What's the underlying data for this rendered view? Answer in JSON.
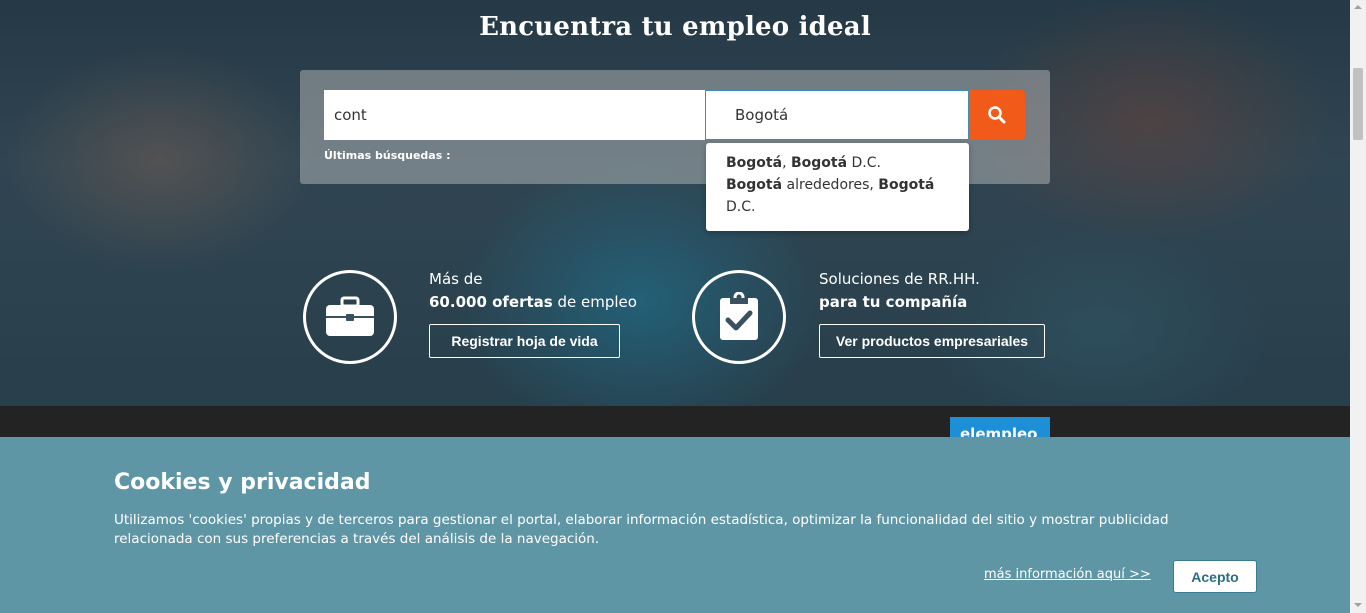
{
  "hero": {
    "title": "Encuentra tu empleo ideal"
  },
  "search": {
    "keyword_value": "cont",
    "location_value": "Bogotá",
    "recent_label": "Últimas búsquedas :",
    "button_icon": "search-icon",
    "button_color": "#f25a1a"
  },
  "suggestions": [
    {
      "bold1": "Bogotá",
      "sep": ", ",
      "bold2": "Bogotá",
      "rest": " D.C."
    },
    {
      "bold1": "Bogotá",
      "sep": " alrededores, ",
      "bold2": "Bogotá",
      "rest": " D.C."
    }
  ],
  "features": {
    "candidates": {
      "icon": "briefcase-icon",
      "line1": "Más de",
      "line2_bold": "60.000 ofertas",
      "line2_rest": " de empleo",
      "button": "Registrar hoja de vida"
    },
    "companies": {
      "icon": "clipboard-check-icon",
      "line1": "Soluciones de RR.HH.",
      "line2_bold": "para tu compañía",
      "button": "Ver productos empresariales"
    }
  },
  "logo": {
    "text": "elempleo"
  },
  "cookies": {
    "title": "Cookies y privacidad",
    "text": "Utilizamos 'cookies' propias y de terceros para gestionar el portal, elaborar información estadística, optimizar la funcionalidad del sitio y mostrar publicidad relacionada con sus preferencias a través del análisis de la navegación.",
    "more_link": "más información aquí >>",
    "accept": "Acepto",
    "panel_color": "#5f96a6"
  }
}
